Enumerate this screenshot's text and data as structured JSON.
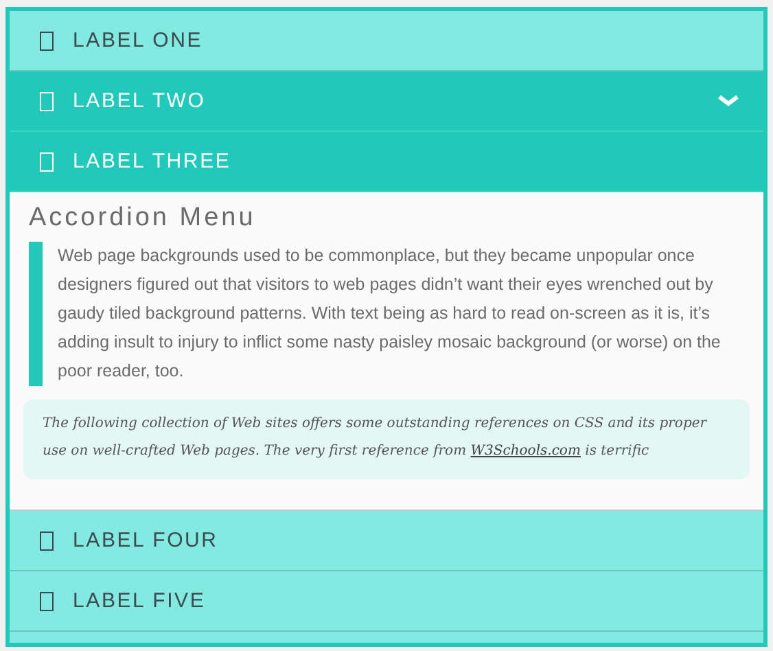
{
  "items": [
    {
      "label": "LABEL ONE",
      "hovered": false,
      "expanded": false
    },
    {
      "label": "LABEL TWO",
      "hovered": true,
      "expanded": false
    },
    {
      "label": "LABEL THREE",
      "hovered": false,
      "expanded": true,
      "content": {
        "title": "Accordion Menu",
        "quote": "Web page backgrounds used to be commonplace, but they became unpopular once designers figured out that visitors to web pages didn’t want their eyes wrenched out by gaudy tiled background patterns. With text being as hard to read on-screen as it is, it’s adding insult to injury to inflict some nasty paisley mosaic background (or worse) on the poor reader, too.",
        "note": "The following collection of Web sites offers some outstanding references on CSS and its proper use on well-crafted Web pages. The very first reference from",
        "link": "W3Schools.com",
        "note_end": "is terrific"
      }
    },
    {
      "label": "LABEL FOUR",
      "hovered": false,
      "expanded": false
    },
    {
      "label": "LABEL FIVE",
      "hovered": false,
      "expanded": false
    }
  ]
}
